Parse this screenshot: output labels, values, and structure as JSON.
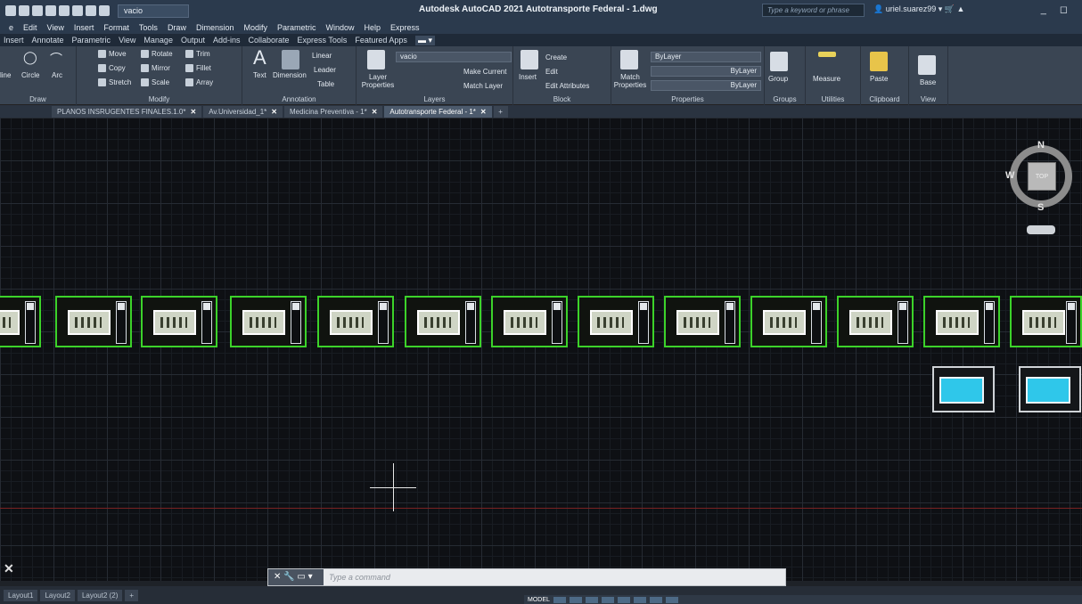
{
  "titlebar": {
    "layer_dropdown": "vacio",
    "title": "Autodesk AutoCAD 2021   Autotransporte Federal - 1.dwg",
    "search_placeholder": "Type a keyword or phrase",
    "user": "uriel.suarez99"
  },
  "menubar": [
    "e",
    "Edit",
    "View",
    "Insert",
    "Format",
    "Tools",
    "Draw",
    "Dimension",
    "Modify",
    "Parametric",
    "Window",
    "Help",
    "Express"
  ],
  "ribbon_tabs": [
    "Insert",
    "Annotate",
    "Parametric",
    "View",
    "Manage",
    "Output",
    "Add-ins",
    "Collaborate",
    "Express Tools",
    "Featured Apps"
  ],
  "ribbon": {
    "draw": {
      "title": "Draw",
      "items": [
        "line",
        "Circle",
        "Arc"
      ]
    },
    "modify": {
      "title": "Modify",
      "items": [
        "Move",
        "Rotate",
        "Trim",
        "Copy",
        "Mirror",
        "Fillet",
        "Stretch",
        "Scale",
        "Array"
      ]
    },
    "annotation": {
      "title": "Annotation",
      "items": [
        "Text",
        "Dimension",
        "Linear",
        "Leader",
        "Table"
      ]
    },
    "layers": {
      "title": "Layers",
      "layer_props": "Layer Properties",
      "current_layer": "vacio",
      "make_current": "Make Current",
      "match_layer": "Match Layer"
    },
    "block": {
      "title": "Block",
      "insert": "Insert",
      "create": "Create",
      "edit": "Edit",
      "edit_attributes": "Edit Attributes"
    },
    "properties": {
      "title": "Properties",
      "match": "Match Properties",
      "color": "ByLayer",
      "linetype": "ByLayer",
      "lineweight": "ByLayer"
    },
    "groups": {
      "title": "Groups",
      "group": "Group"
    },
    "utilities": {
      "title": "Utilities",
      "measure": "Measure"
    },
    "clipboard": {
      "title": "Clipboard",
      "paste": "Paste"
    },
    "view": {
      "title": "View",
      "base": "Base"
    }
  },
  "doc_tabs": [
    {
      "label": "PLANOS INSRUGENTES FINALES.1.0*",
      "active": false
    },
    {
      "label": "Av.Universidad_1*",
      "active": false
    },
    {
      "label": "Medicina Preventiva - 1*",
      "active": false
    },
    {
      "label": "Autotransporte Federal - 1*",
      "active": true
    }
  ],
  "viewcube": {
    "north": "N",
    "south": "S",
    "west": "W",
    "face": "TOP"
  },
  "cmdline": {
    "placeholder": "Type a command"
  },
  "layout_tabs": [
    "Layout1",
    "Layout2",
    "Layout2 (2)"
  ],
  "statusbar": {
    "model": "MODEL"
  },
  "colors": {
    "sheet_frame": "#3cd22a",
    "background": "#0e1014",
    "accent": "#2fc7ea"
  }
}
